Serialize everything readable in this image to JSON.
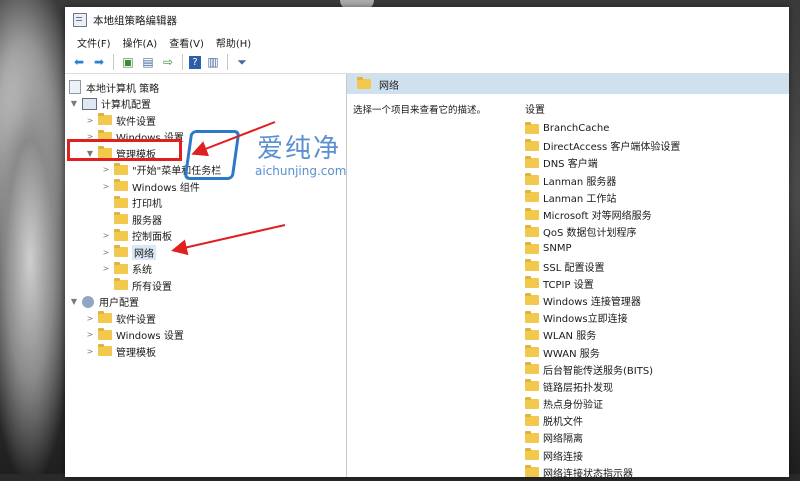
{
  "window": {
    "title": "本地组策略编辑器"
  },
  "menu": [
    "文件(F)",
    "操作(A)",
    "查看(V)",
    "帮助(H)"
  ],
  "toolbar": [
    "back-icon",
    "forward-icon",
    "up-icon",
    "show-hide-tree-icon",
    "export-icon",
    "help-icon",
    "properties-icon",
    "filter-icon"
  ],
  "tree": {
    "root": "本地计算机 策略",
    "computer": "计算机配置",
    "software": "软件设置",
    "windows_settings": "Windows 设置",
    "admin_templates": "管理模板",
    "start_menu": "\"开始\"菜单和任务栏",
    "windows_components": "Windows 组件",
    "printers": "打印机",
    "server": "服务器",
    "control_panel": "控制面板",
    "network": "网络",
    "system": "系统",
    "all_settings": "所有设置",
    "user": "用户配置",
    "user_software": "软件设置",
    "user_windows": "Windows 设置",
    "user_admin": "管理模板"
  },
  "right_pane": {
    "title": "网络",
    "description": "选择一个项目来查看它的描述。",
    "settings_header": "设置",
    "items": [
      "BranchCache",
      "DirectAccess 客户端体验设置",
      "DNS 客户端",
      "Lanman 服务器",
      "Lanman 工作站",
      "Microsoft 对等网络服务",
      "QoS 数据包计划程序",
      "SNMP",
      "SSL 配置设置",
      "TCPIP 设置",
      "Windows 连接管理器",
      "Windows立即连接",
      "WLAN 服务",
      "WWAN 服务",
      "后台智能传送服务(BITS)",
      "链路层拓扑发现",
      "热点身份验证",
      "脱机文件",
      "网络隔离",
      "网络连接",
      "网络连接状态指示器"
    ]
  },
  "watermark": {
    "text": "爱纯净",
    "sub": "aichunjing.com"
  },
  "colors": {
    "annotation": "#e02020",
    "header": "#cfe0ef",
    "folder": "#f2c94c"
  }
}
